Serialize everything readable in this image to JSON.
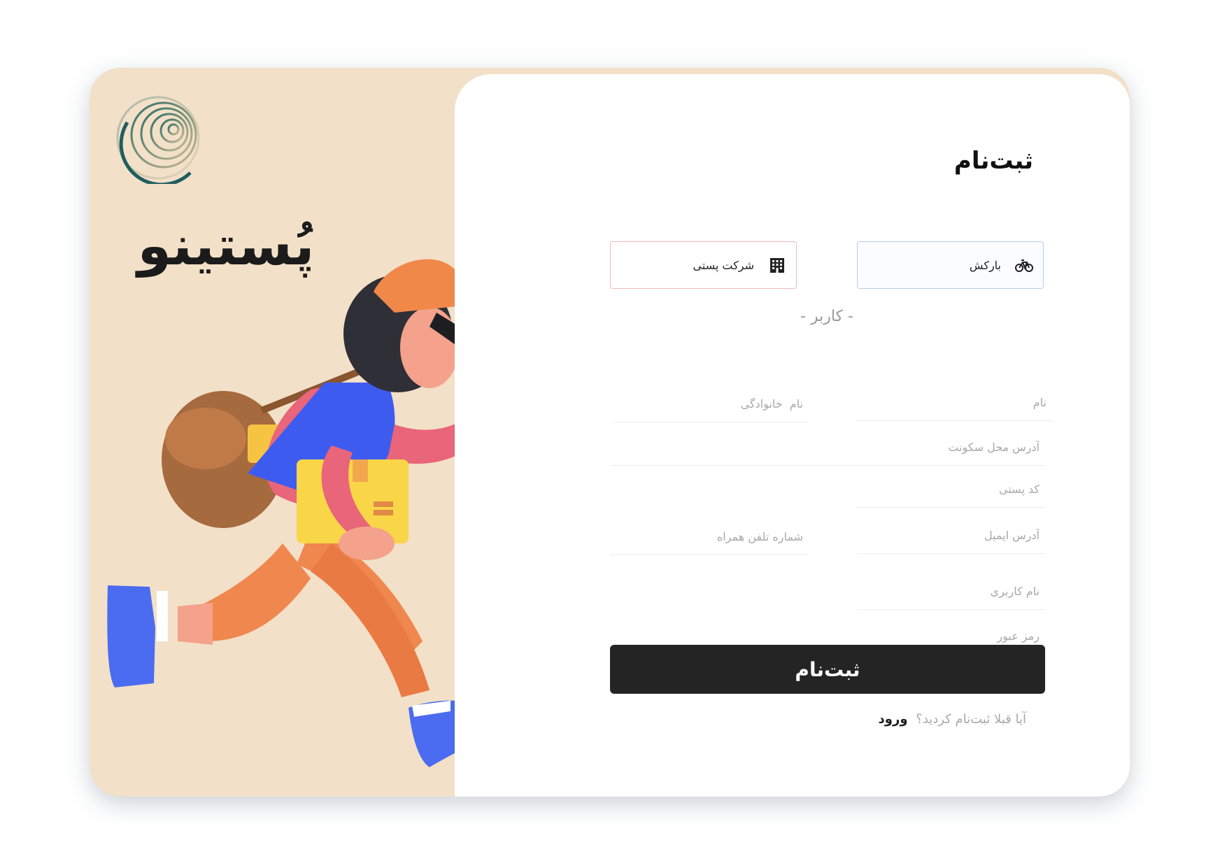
{
  "brand": {
    "name": "پُستینو"
  },
  "form": {
    "title": "ثبت‌نام",
    "roles": [
      {
        "label": "بارکش",
        "icon": "bicycle-icon",
        "accent": "#b9c8e8"
      },
      {
        "label": "شرکت پستی",
        "icon": "building-icon",
        "accent": "#f0b8b8"
      }
    ],
    "section_label": "- کاربر -",
    "fields": {
      "first_name": "نام",
      "last_name": "نام  خانوادگی",
      "address": "آدرس محل سکونت",
      "postal_code": "کد پستی",
      "email": "آدرس ایمیل",
      "phone": "شماره تلفن همراه",
      "username": "نام کاربری",
      "password": "رمز عبور"
    },
    "submit_label": "ثبت‌نام",
    "login_prompt": "آیا قبلا ثبت‌نام کردید؟",
    "login_link": "ورود"
  },
  "colors": {
    "background_panel": "#f2e0c8",
    "submit_button": "#242424",
    "courier_border": "#b9c8e8",
    "company_border": "#f0b8b8"
  }
}
